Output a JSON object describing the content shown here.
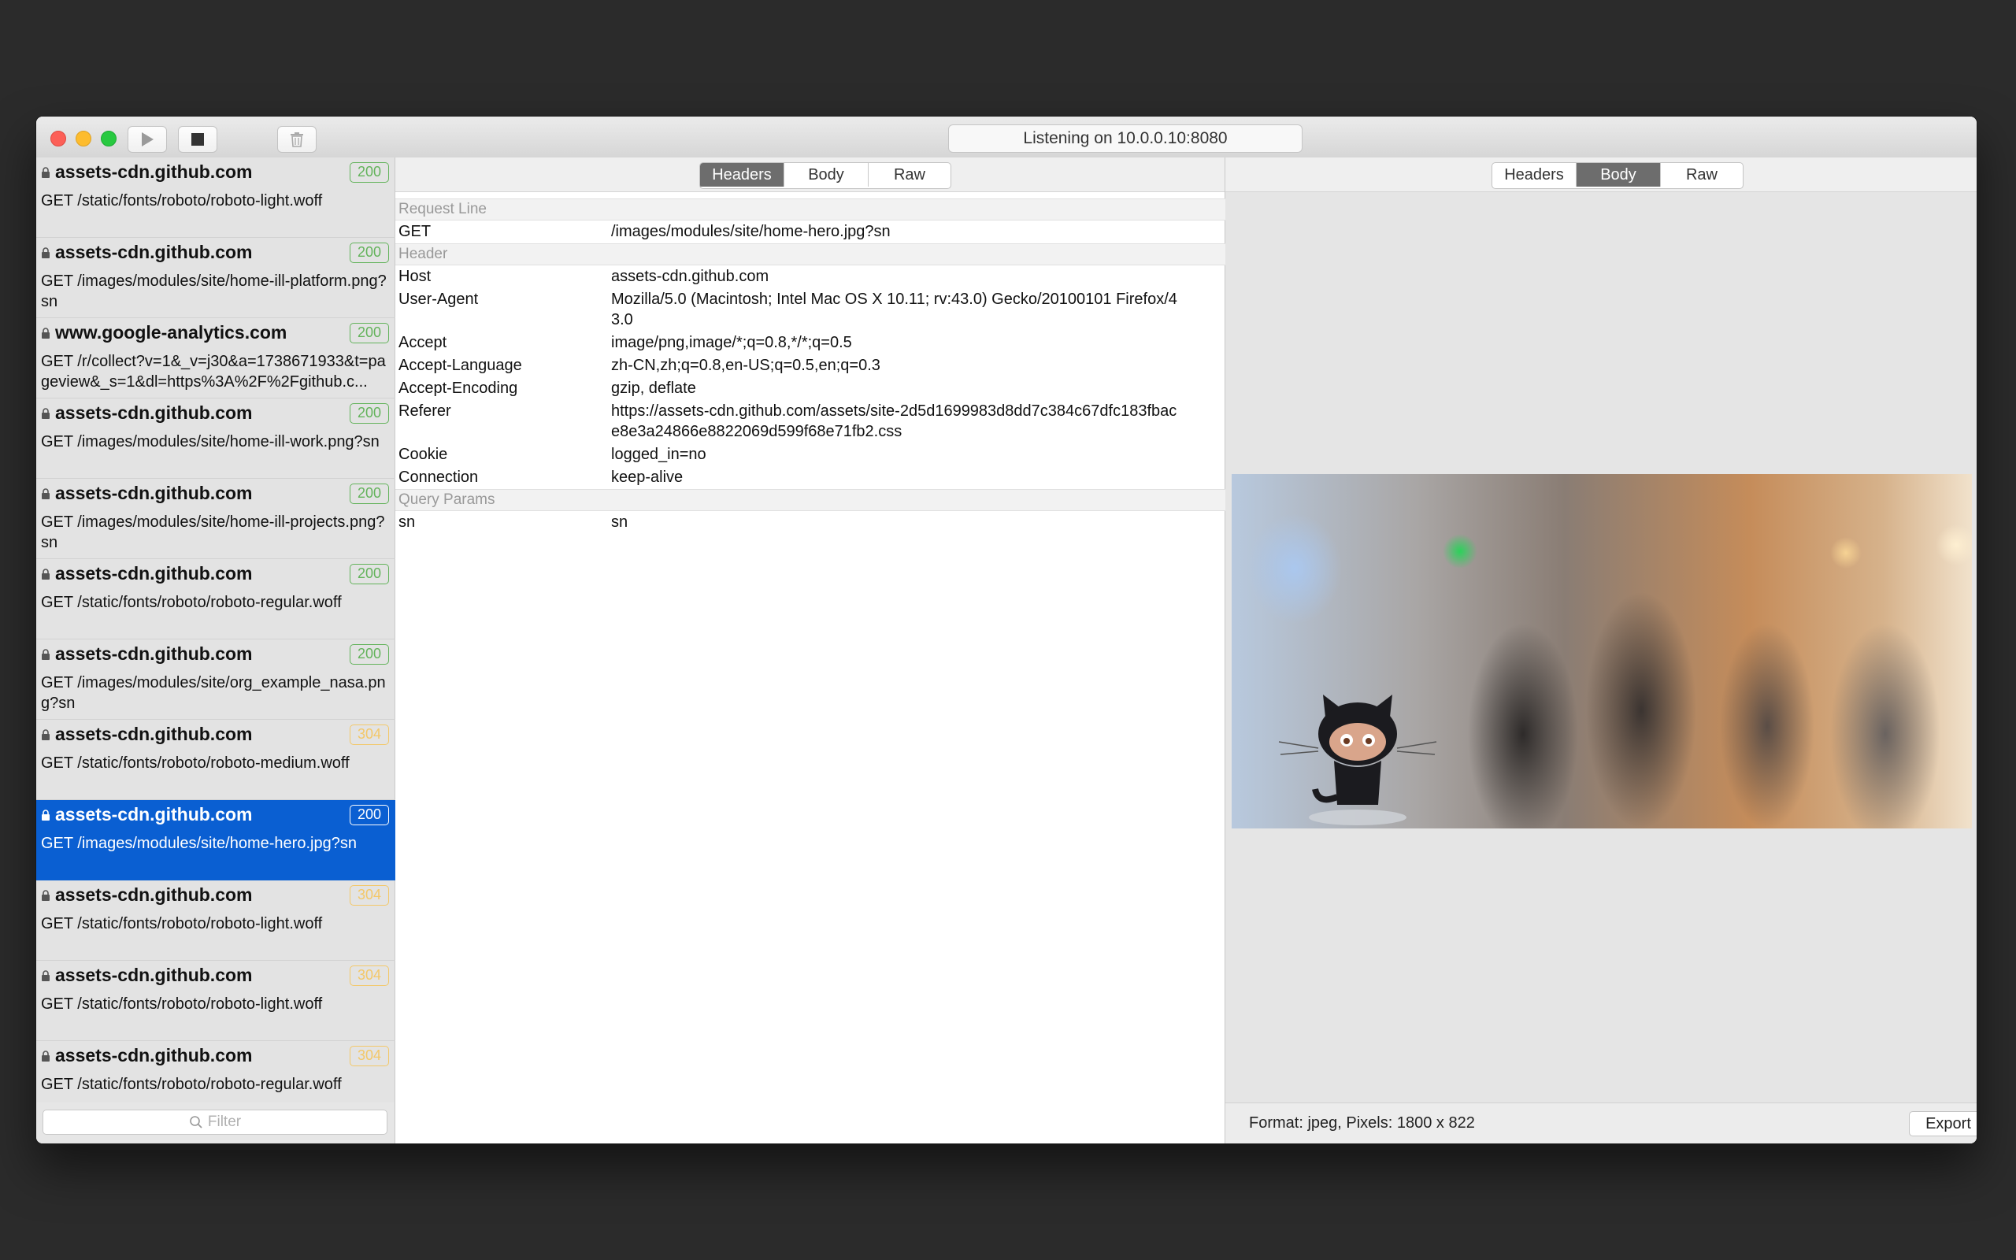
{
  "titlebar": {
    "status": "Listening on 10.0.0.10:8080",
    "play_icon": "play-icon",
    "stop_icon": "stop-icon",
    "trash_icon": "trash-icon"
  },
  "requests": [
    {
      "host": "assets-cdn.github.com",
      "code": "200",
      "path": "GET /static/fonts/roboto/roboto-light.woff"
    },
    {
      "host": "assets-cdn.github.com",
      "code": "200",
      "path": "GET /images/modules/site/home-ill-platform.png?sn"
    },
    {
      "host": "www.google-analytics.com",
      "code": "200",
      "path": "GET /r/collect?v=1&_v=j30&a=1738671933&t=pageview&_s=1&dl=https%3A%2F%2Fgithub.c..."
    },
    {
      "host": "assets-cdn.github.com",
      "code": "200",
      "path": "GET /images/modules/site/home-ill-work.png?sn"
    },
    {
      "host": "assets-cdn.github.com",
      "code": "200",
      "path": "GET /images/modules/site/home-ill-projects.png?sn"
    },
    {
      "host": "assets-cdn.github.com",
      "code": "200",
      "path": "GET /static/fonts/roboto/roboto-regular.woff"
    },
    {
      "host": "assets-cdn.github.com",
      "code": "200",
      "path": "GET /images/modules/site/org_example_nasa.png?sn"
    },
    {
      "host": "assets-cdn.github.com",
      "code": "304",
      "path": "GET /static/fonts/roboto/roboto-medium.woff"
    },
    {
      "host": "assets-cdn.github.com",
      "code": "200",
      "path": "GET /images/modules/site/home-hero.jpg?sn"
    },
    {
      "host": "assets-cdn.github.com",
      "code": "304",
      "path": "GET /static/fonts/roboto/roboto-light.woff"
    },
    {
      "host": "assets-cdn.github.com",
      "code": "304",
      "path": "GET /static/fonts/roboto/roboto-light.woff"
    },
    {
      "host": "assets-cdn.github.com",
      "code": "304",
      "path": "GET /static/fonts/roboto/roboto-regular.woff"
    }
  ],
  "selected_request_index": 8,
  "filter": {
    "placeholder": "Filter"
  },
  "request_pane": {
    "tabs": [
      "Headers",
      "Body",
      "Raw"
    ],
    "active_tab": "Headers",
    "request_line_title": "Request Line",
    "request_line": {
      "method": "GET",
      "path": "/images/modules/site/home-hero.jpg?sn"
    },
    "header_title": "Header",
    "headers": [
      {
        "k": "Host",
        "v": "assets-cdn.github.com"
      },
      {
        "k": "User-Agent",
        "v": "Mozilla/5.0 (Macintosh; Intel Mac OS X 10.11; rv:43.0) Gecko/20100101 Firefox/43.0"
      },
      {
        "k": "Accept",
        "v": "image/png,image/*;q=0.8,*/*;q=0.5"
      },
      {
        "k": "Accept-Language",
        "v": "zh-CN,zh;q=0.8,en-US;q=0.5,en;q=0.3"
      },
      {
        "k": "Accept-Encoding",
        "v": "gzip, deflate"
      },
      {
        "k": "Referer",
        "v": "https://assets-cdn.github.com/assets/site-2d5d1699983d8dd7c384c67dfc183fbace8e3a24866e8822069d599f68e71fb2.css"
      },
      {
        "k": "Cookie",
        "v": "logged_in=no"
      },
      {
        "k": "Connection",
        "v": "keep-alive"
      }
    ],
    "query_title": "Query Params",
    "query": [
      {
        "k": "sn",
        "v": "sn"
      }
    ]
  },
  "response_pane": {
    "tabs": [
      "Headers",
      "Body",
      "Raw"
    ],
    "active_tab": "Body",
    "image_info": "Format: jpeg, Pixels: 1800 x 822",
    "export_label": "Export"
  },
  "colors": {
    "selection": "#0a5fd2",
    "status_ok": "#63b35b",
    "status_not_modified": "#f3c869"
  }
}
